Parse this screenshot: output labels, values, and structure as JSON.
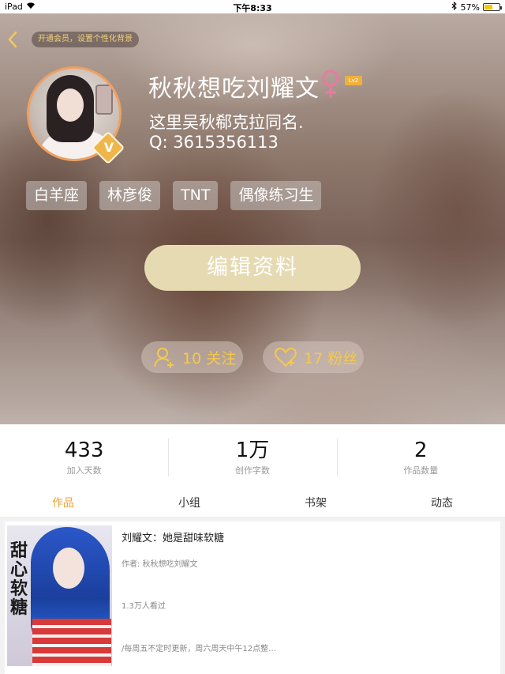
{
  "status_bar": {
    "device": "iPad",
    "time": "下午8:33",
    "battery": "57%",
    "battery_level": 0.57
  },
  "header": {
    "vip_prompt": "开通会员，设置个性化背景",
    "name": "秋秋想吃刘耀文",
    "gender_icon": "female-symbol-icon",
    "level": "Lv2",
    "bio_line1": "这里吴秋郗克拉同名.",
    "bio_line2": "Q: 3615356113",
    "tags": [
      "白羊座",
      "林彦俊",
      "TNT",
      "偶像练习生"
    ],
    "edit_profile_label": "编辑资料",
    "follow_label": "10 关注",
    "fans_label": "17 粉丝",
    "accent_color": "#f5c94a"
  },
  "stats": [
    {
      "value": "433",
      "label": "加入天数"
    },
    {
      "value": "1万",
      "label": "创作字数"
    },
    {
      "value": "2",
      "label": "作品数量"
    }
  ],
  "tabs": [
    "作品",
    "小组",
    "书架",
    "动态"
  ],
  "active_tab": "作品",
  "works": [
    {
      "cover_title": "甜心软糖",
      "title": "刘耀文：她是甜味软糖",
      "author": "作者: 秋秋想吃刘耀文",
      "views": "1.3万人看过",
      "note": "/每周五不定时更新，周六周天中午12点整…"
    }
  ]
}
